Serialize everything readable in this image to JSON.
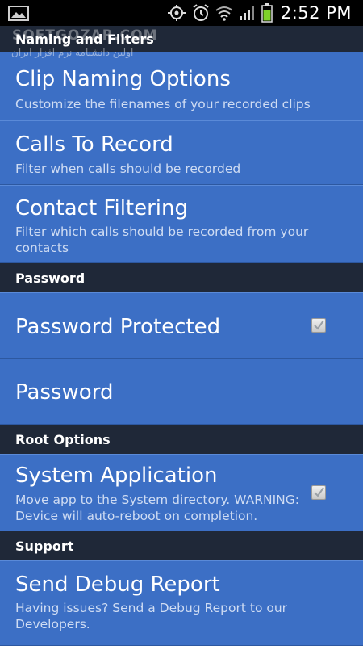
{
  "status_bar": {
    "time": "2:52 PM",
    "icons": [
      "gallery-icon",
      "location-icon",
      "alarm-icon",
      "wifi-icon",
      "signal-icon",
      "battery-icon"
    ]
  },
  "watermark": {
    "title": "SOFTGOZAR.COM",
    "subtitle": "اولین دانشنامه نرم افزار ایران"
  },
  "sections": {
    "naming": {
      "header": "Naming and Filters",
      "items": [
        {
          "title": "Clip Naming Options",
          "summary": "Customize the filenames of your recorded clips"
        },
        {
          "title": "Calls To Record",
          "summary": "Filter when calls should be recorded"
        },
        {
          "title": "Contact Filtering",
          "summary": "Filter which calls should be recorded from your contacts"
        }
      ]
    },
    "password": {
      "header": "Password",
      "items": [
        {
          "title": "Password Protected",
          "checked": true
        },
        {
          "title": "Password"
        }
      ]
    },
    "root": {
      "header": "Root Options",
      "items": [
        {
          "title": "System Application",
          "summary": "Move app to the System directory. WARNING: Device will auto-reboot on completion.",
          "checked": true
        }
      ]
    },
    "support": {
      "header": "Support",
      "items": [
        {
          "title": "Send Debug Report",
          "summary": "Having issues? Send a Debug Report to our Developers."
        }
      ]
    }
  },
  "colors": {
    "item_bg": "#3c6fc5",
    "header_bg": "#1f2838",
    "status_bar_bg": "#000000"
  }
}
